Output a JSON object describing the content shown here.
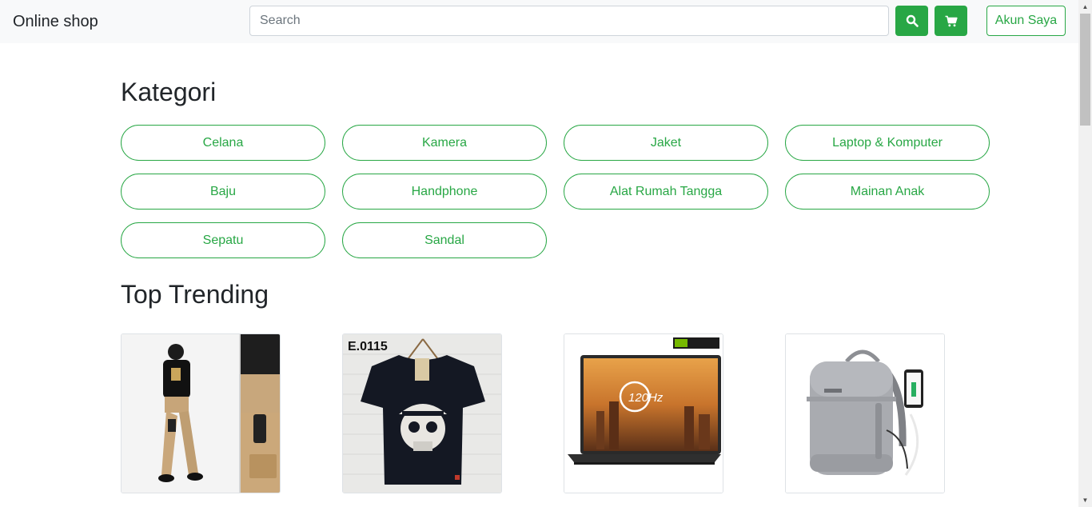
{
  "navbar": {
    "brand": "Online shop",
    "search_placeholder": "Search",
    "account_label": "Akun Saya"
  },
  "kategori": {
    "title": "Kategori",
    "items": [
      "Celana",
      "Kamera",
      "Jaket",
      "Laptop & Komputer",
      "Baju",
      "Handphone",
      "Alat Rumah Tangga",
      "Mainan Anak",
      "Sepatu",
      "Sandal"
    ]
  },
  "trending": {
    "title": "Top Trending",
    "products": [
      {
        "image": "cargo-pants-photo"
      },
      {
        "image": "skull-tshirt-photo",
        "code": "E.0115"
      },
      {
        "image": "gaming-laptop-photo",
        "screen_text": "120Hz"
      },
      {
        "image": "laptop-backpack-photo"
      }
    ]
  },
  "colors": {
    "accent": "#28a745",
    "navbar_bg": "#f8f9fa"
  }
}
